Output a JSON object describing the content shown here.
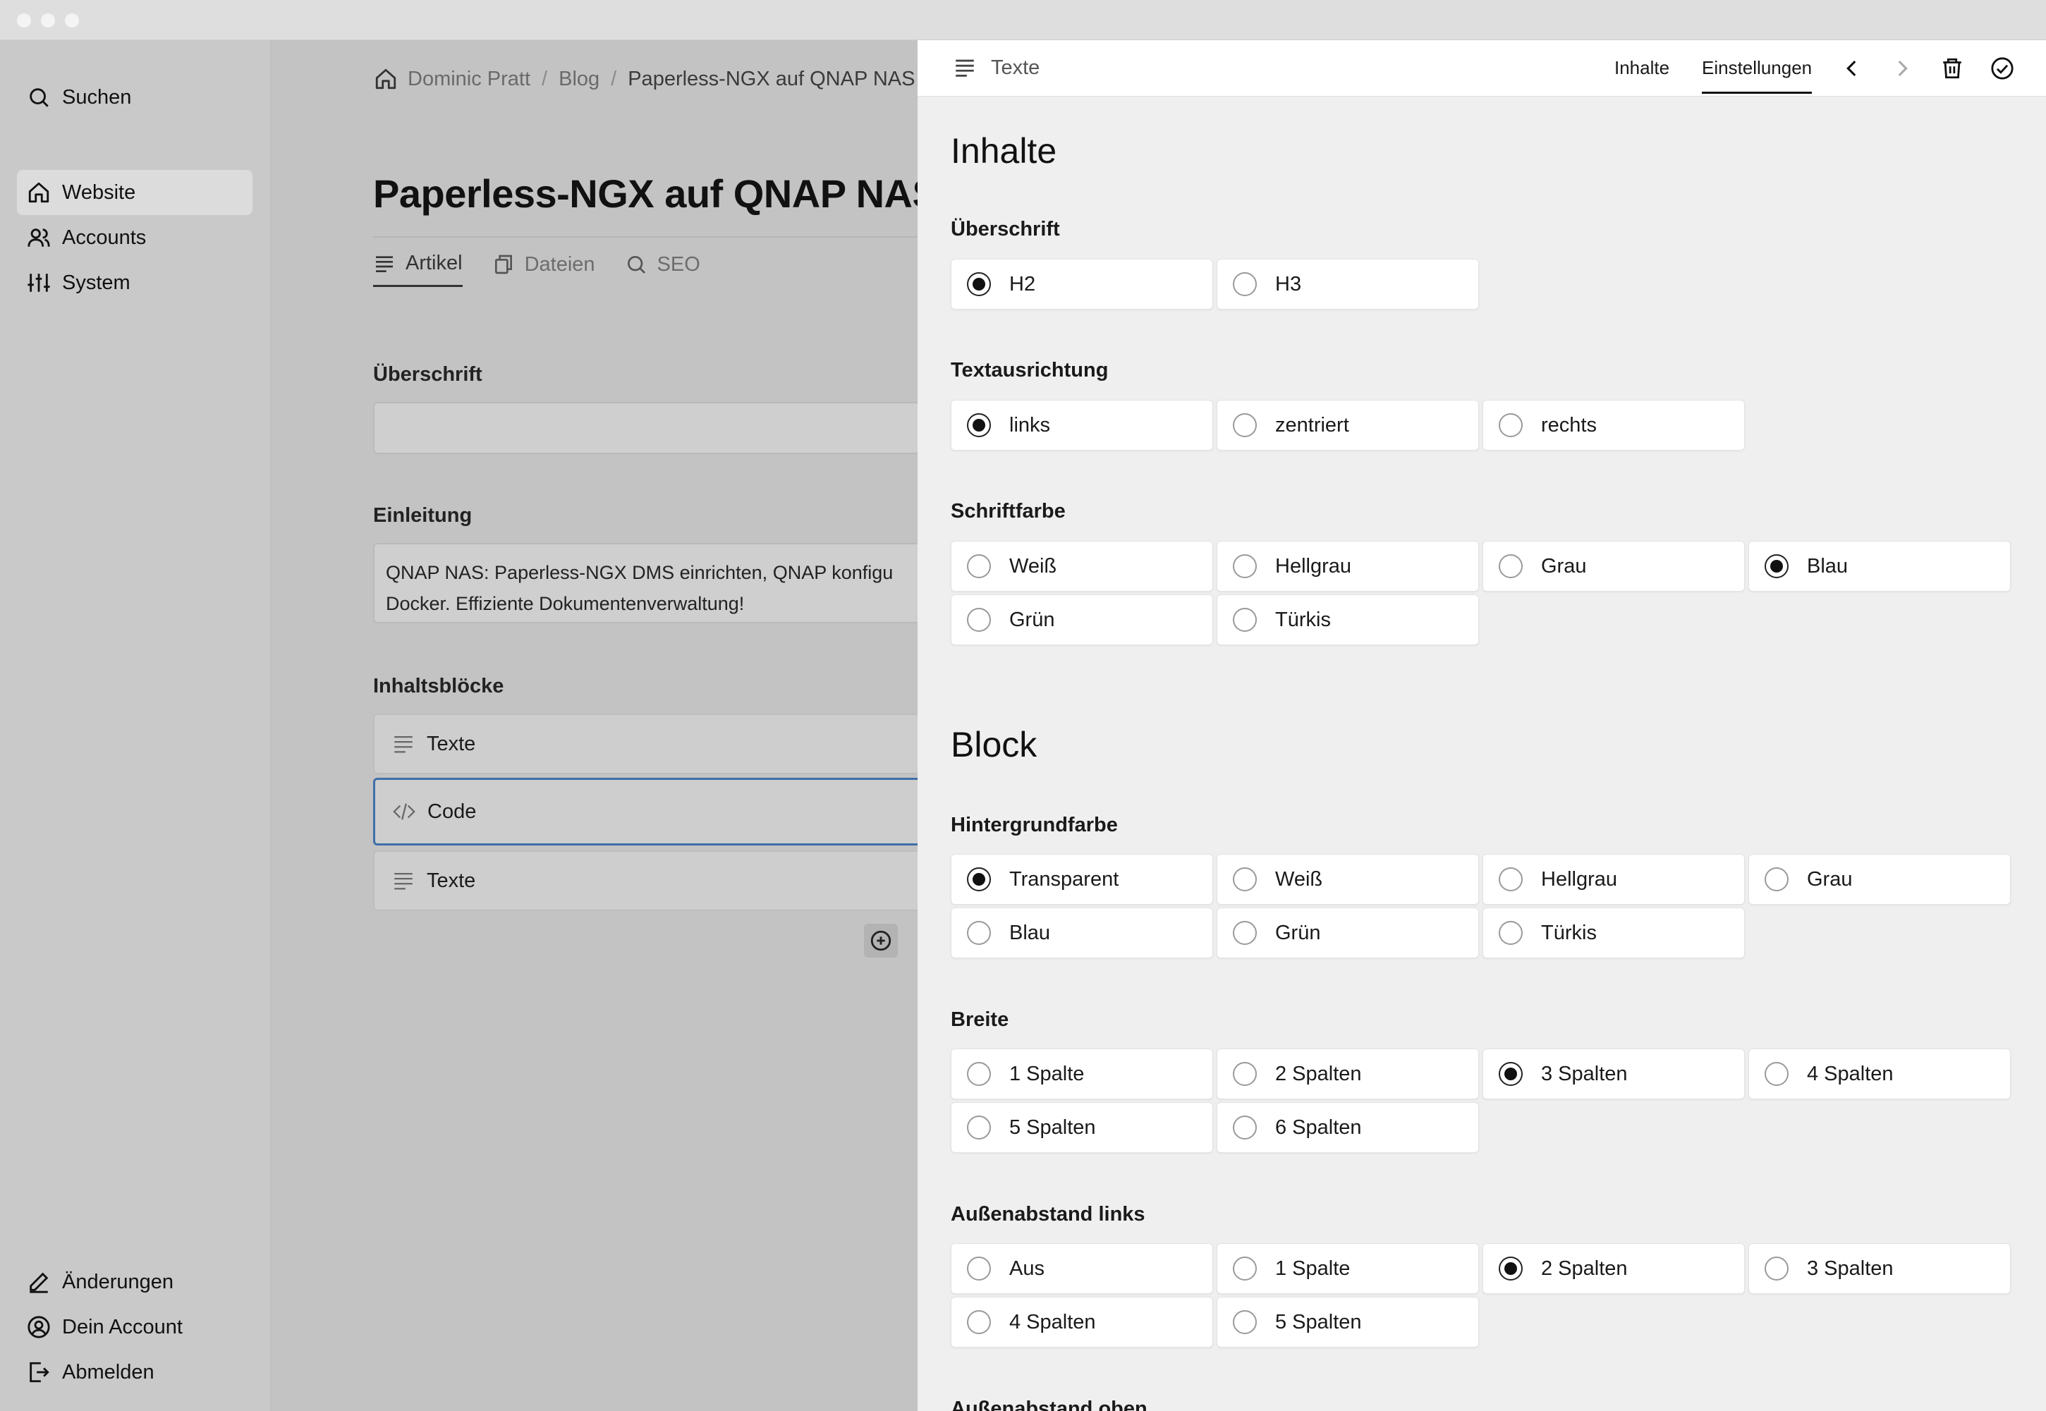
{
  "sidebar": {
    "search": "Suchen",
    "nav": [
      "Website",
      "Accounts",
      "System"
    ],
    "bottom": [
      "Änderungen",
      "Dein Account",
      "Abmelden"
    ]
  },
  "main": {
    "breadcrumb": [
      "Dominic Pratt",
      "Blog",
      "Paperless-NGX auf QNAP NAS"
    ],
    "title": "Paperless-NGX auf QNAP NAS",
    "tabs": [
      "Artikel",
      "Dateien",
      "SEO"
    ],
    "heading_label": "Überschrift",
    "heading_value": "",
    "intro_label": "Einleitung",
    "intro_lines": [
      "QNAP NAS: Paperless-NGX DMS einrichten, QNAP konfigu",
      "Docker. Effiziente Dokumentenverwaltung!"
    ],
    "blocks_label": "Inhaltsblöcke",
    "blocks": [
      "Texte",
      "Code",
      "Texte"
    ]
  },
  "panel": {
    "title": "Texte",
    "tabs": [
      "Inhalte",
      "Einstellungen"
    ],
    "active_tab": "Einstellungen",
    "section1": "Inhalte",
    "section2": "Block",
    "groups": {
      "ueberschrift": {
        "label": "Überschrift",
        "options": [
          "H2",
          "H3"
        ],
        "selected": "H2"
      },
      "textausrichtung": {
        "label": "Textausrichtung",
        "options": [
          "links",
          "zentriert",
          "rechts"
        ],
        "selected": "links"
      },
      "schriftfarbe": {
        "label": "Schriftfarbe",
        "options": [
          "Weiß",
          "Hellgrau",
          "Grau",
          "Blau",
          "Grün",
          "Türkis"
        ],
        "selected": "Blau"
      },
      "hintergrundfarbe": {
        "label": "Hintergrundfarbe",
        "options": [
          "Transparent",
          "Weiß",
          "Hellgrau",
          "Grau",
          "Blau",
          "Grün",
          "Türkis"
        ],
        "selected": "Transparent"
      },
      "breite": {
        "label": "Breite",
        "options": [
          "1 Spalte",
          "2 Spalten",
          "3 Spalten",
          "4 Spalten",
          "5 Spalten",
          "6 Spalten"
        ],
        "selected": "3 Spalten"
      },
      "aussenabstand_links": {
        "label": "Außenabstand links",
        "options": [
          "Aus",
          "1 Spalte",
          "2 Spalten",
          "3 Spalten",
          "4 Spalten",
          "5 Spalten"
        ],
        "selected": "2 Spalten"
      },
      "aussenabstand_oben": {
        "label": "Außenabstand oben"
      }
    }
  },
  "colors": {
    "selected_border": "#3e6fa8",
    "panel_bg": "#efefef",
    "overlay_bg": "#c3c3c3"
  }
}
